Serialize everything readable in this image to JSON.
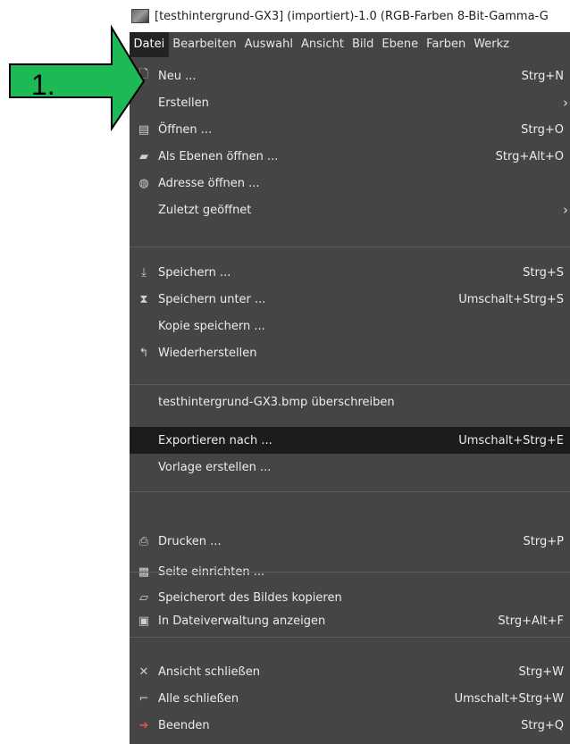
{
  "window": {
    "title": "[testhintergrund-GX3] (importiert)-1.0 (RGB-Farben 8-Bit-Gamma-G"
  },
  "menubar": [
    "Datei",
    "Bearbeiten",
    "Auswahl",
    "Ansicht",
    "Bild",
    "Ebene",
    "Farben",
    "Werkz"
  ],
  "menu": {
    "items": [
      {
        "label": "Neu ...",
        "shortcut": "Strg+N",
        "icon": "new-file-icon"
      },
      {
        "label": "Erstellen",
        "submenu": "›"
      },
      {
        "label": "Öffnen ...",
        "shortcut": "Strg+O",
        "icon": "open-icon"
      },
      {
        "label": "Als Ebenen öffnen ...",
        "shortcut": "Strg+Alt+O",
        "icon": "open-layers-icon"
      },
      {
        "label": "Adresse öffnen ...",
        "icon": "globe-icon"
      },
      {
        "label": "Zuletzt geöffnet",
        "submenu": "›"
      },
      {
        "label": "Speichern ...",
        "shortcut": "Strg+S",
        "icon": "save-icon"
      },
      {
        "label": "Speichern unter ...",
        "shortcut": "Umschalt+Strg+S",
        "icon": "save-as-icon"
      },
      {
        "label": "Kopie speichern ..."
      },
      {
        "label": "Wiederherstellen",
        "icon": "revert-icon"
      },
      {
        "label": "testhintergrund-GX3.bmp überschreiben"
      },
      {
        "label": "Exportieren nach ...",
        "shortcut": "Umschalt+Strg+E"
      },
      {
        "label": "Vorlage erstellen ..."
      },
      {
        "label": "Drucken ...",
        "shortcut": "Strg+P",
        "icon": "print-icon"
      },
      {
        "label": "Seite einrichten ...",
        "icon": "page-setup-icon"
      },
      {
        "label": "Speicherort des Bildes kopieren",
        "icon": "copy-location-icon"
      },
      {
        "label": "In Dateiverwaltung anzeigen",
        "shortcut": "Strg+Alt+F",
        "icon": "file-manager-icon"
      },
      {
        "label": "Ansicht schließen",
        "shortcut": "Strg+W",
        "icon": "close-icon"
      },
      {
        "label": "Alle schließen",
        "shortcut": "Umschalt+Strg+W",
        "icon": "close-all-icon"
      },
      {
        "label": "Beenden",
        "shortcut": "Strg+Q",
        "icon": "quit-icon"
      }
    ]
  },
  "annotation": {
    "label": "1.",
    "fill": "#1db954",
    "stroke": "#000000"
  },
  "colors": {
    "menu_bg": "#454545",
    "highlight_bg": "#1c1c1c",
    "text": "#ececec"
  }
}
